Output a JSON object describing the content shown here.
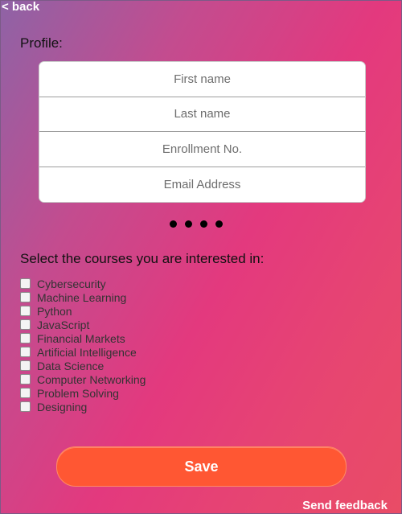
{
  "nav": {
    "back_label": "< back"
  },
  "profile": {
    "heading": "Profile:",
    "fields": {
      "first_name_placeholder": "First name",
      "last_name_placeholder": "Last name",
      "enrollment_placeholder": "Enrollment No.",
      "email_placeholder": "Email Address"
    },
    "step_dots": 4
  },
  "courses": {
    "heading": "Select the courses you are interested in:",
    "items": [
      {
        "label": "Cybersecurity",
        "checked": false
      },
      {
        "label": "Machine Learning",
        "checked": false
      },
      {
        "label": "Python",
        "checked": false
      },
      {
        "label": "JavaScript",
        "checked": false
      },
      {
        "label": "Financial Markets",
        "checked": false
      },
      {
        "label": "Artificial Intelligence",
        "checked": false
      },
      {
        "label": "Data Science",
        "checked": false
      },
      {
        "label": "Computer Networking",
        "checked": false
      },
      {
        "label": "Problem Solving",
        "checked": false
      },
      {
        "label": "Designing",
        "checked": false
      }
    ]
  },
  "actions": {
    "save_label": "Save",
    "feedback_label": "Send feedback"
  },
  "colors": {
    "save_button": "#ff5733",
    "text_dark": "#111111",
    "text_light": "#ffffff"
  }
}
